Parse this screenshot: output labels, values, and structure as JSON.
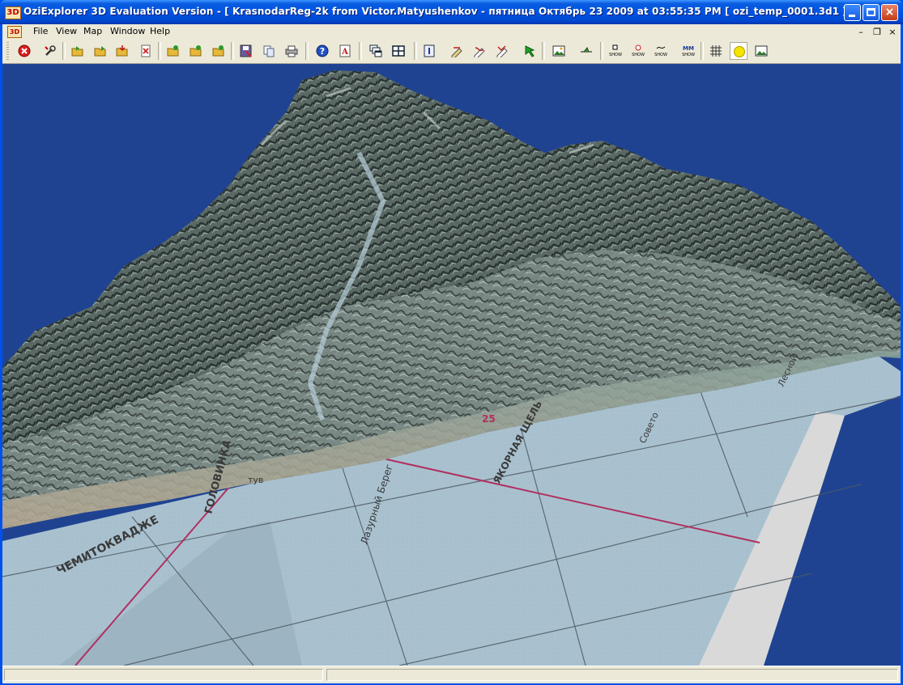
{
  "window": {
    "title": "OziExplorer 3D Evaluation Version - [ KrasnodarReg-2k from Victor.Matyushenkov - пятница Октябрь 23 2009  at  03:55:35 PM  [ ozi_temp_0001.3d1 ]]",
    "app_icon_label": "3D",
    "controls": {
      "minimize": "",
      "maximize": "",
      "close": "×"
    }
  },
  "menubar": {
    "items": [
      {
        "label": "File"
      },
      {
        "label": "View"
      },
      {
        "label": "Map"
      },
      {
        "label": "Window"
      },
      {
        "label": "Help"
      }
    ],
    "mdi_icon_label": "3D",
    "mdi_controls": {
      "minimize": "–",
      "restore": "❐",
      "close": "×"
    }
  },
  "toolbar": {
    "buttons": [
      {
        "name": "close-scene",
        "icon": "stop-icon"
      },
      {
        "name": "tools",
        "icon": "wrench-icon"
      },
      {
        "name": "open-1",
        "icon": "open-folder-icon"
      },
      {
        "name": "open-2",
        "icon": "open-folder-icon"
      },
      {
        "name": "open-3",
        "icon": "open-folder-icon"
      },
      {
        "name": "remove",
        "icon": "delete-icon"
      },
      {
        "name": "load-waypoints",
        "icon": "folder-icon"
      },
      {
        "name": "load-tracks",
        "icon": "folder-icon"
      },
      {
        "name": "load-routes",
        "icon": "folder-icon"
      },
      {
        "name": "save",
        "icon": "save-icon"
      },
      {
        "name": "copy",
        "icon": "copy-icon"
      },
      {
        "name": "print",
        "icon": "print-icon"
      },
      {
        "name": "help",
        "icon": "help-icon"
      },
      {
        "name": "about",
        "icon": "about-icon"
      },
      {
        "name": "cascade",
        "icon": "cascade-icon"
      },
      {
        "name": "tile",
        "icon": "tile-icon"
      },
      {
        "name": "info",
        "icon": "info-icon"
      },
      {
        "name": "waypoint",
        "icon": "waypoint-icon"
      },
      {
        "name": "track",
        "icon": "track-icon"
      },
      {
        "name": "route",
        "icon": "route-icon"
      },
      {
        "name": "go",
        "icon": "arrow-icon"
      },
      {
        "name": "map-image",
        "icon": "picture-icon"
      },
      {
        "name": "plane",
        "icon": "plane-icon"
      },
      {
        "name": "show-waypoints",
        "icon": "show-icon",
        "caption": "SHOW"
      },
      {
        "name": "show-points",
        "icon": "show-icon",
        "caption": "SHOW"
      },
      {
        "name": "show-tracks",
        "icon": "show-icon",
        "caption": "SHOW"
      },
      {
        "name": "show-mm",
        "icon": "show-icon",
        "caption": "SHOW"
      },
      {
        "name": "grid",
        "icon": "grid-icon"
      },
      {
        "name": "sun",
        "icon": "sun-icon"
      },
      {
        "name": "snapshot",
        "icon": "picture-icon"
      }
    ],
    "mm_label": "MM"
  },
  "map": {
    "labels": [
      {
        "name": "map-label-chemitokvadzhe",
        "text": "ЧЕМИТОКВАДЖЕ"
      },
      {
        "name": "map-label-golovinka",
        "text": "ГОЛОВИНКА"
      },
      {
        "name": "map-label-lazurny-bereg",
        "text": "Лазурный Берег"
      },
      {
        "name": "map-label-yakornaya-shchel",
        "text": "ЯКОРНАЯ ЩЕЛЬ"
      },
      {
        "name": "map-label-sovet",
        "text": "Совето"
      },
      {
        "name": "map-label-lesnoy",
        "text": "Лесной"
      },
      {
        "name": "map-label-25",
        "text": "25"
      },
      {
        "name": "map-label-tub",
        "text": "тув"
      }
    ]
  },
  "status": {
    "panel1": "",
    "panel2": ""
  },
  "colors": {
    "sky": "#1f4391",
    "sea": "#a9c1cf",
    "terrain_dark": "#3b4542",
    "terrain_light": "#8ea09a",
    "border_line": "#b03060"
  }
}
